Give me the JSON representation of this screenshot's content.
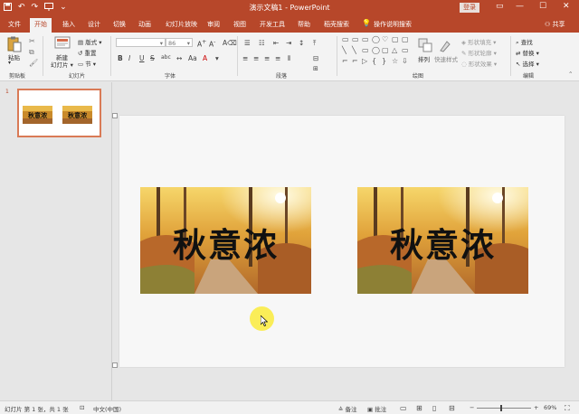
{
  "titlebar": {
    "title": "演示文稿1 - PowerPoint",
    "login": "登录",
    "qat": {
      "save_icon": "save-icon",
      "undo_icon": "undo-icon",
      "redo_icon": "redo-icon",
      "present_icon": "present-icon",
      "customize_icon": "customize-icon"
    },
    "controls": {
      "ribbon_options": "▭",
      "minimize": "—",
      "maximize": "☐",
      "close": "✕"
    }
  },
  "menu": {
    "tabs": [
      "文件",
      "开始",
      "插入",
      "设计",
      "切换",
      "动画",
      "幻灯片放映",
      "审阅",
      "视图",
      "开发工具",
      "帮助",
      "稻壳搜索"
    ],
    "active_tab": "开始",
    "tell_me": "操作说明搜索",
    "share": "共享"
  },
  "ribbon": {
    "clipboard": {
      "paste": "粘贴",
      "label": "剪贴板"
    },
    "slides": {
      "new_slide": "新建",
      "new_slide_sub": "幻灯片 ▾",
      "layout": "版式 ▾",
      "reset": "重置",
      "section": "节 ▾",
      "label": "幻灯片"
    },
    "font": {
      "font_name": "",
      "font_size": "86",
      "bold": "B",
      "italic": "I",
      "underline": "U",
      "strike": "S",
      "shadow": "abc",
      "label": "字体"
    },
    "paragraph": {
      "label": "段落"
    },
    "drawing": {
      "arrange": "排列",
      "quick_styles": "快速样式",
      "fill": "形状填充 ▾",
      "outline": "形状轮廓 ▾",
      "effects": "形状效果 ▾",
      "label": "绘图"
    },
    "editing": {
      "find": "查找",
      "replace": "替换 ▾",
      "select": "选择 ▾",
      "label": "编辑"
    }
  },
  "thumbnail": {
    "number": "1"
  },
  "slide": {
    "left_title": "秋意浓",
    "right_title": "秋意浓"
  },
  "statusbar": {
    "slide_info": "幻灯片 第 1 张，共 1 张",
    "language": "中文(中国)",
    "notes": "备注",
    "comments": "批注",
    "zoom": "69%"
  },
  "colors": {
    "accent": "#b7472a",
    "thumb_border": "#d97a56",
    "cursor_highlight": "#faeb3c"
  }
}
